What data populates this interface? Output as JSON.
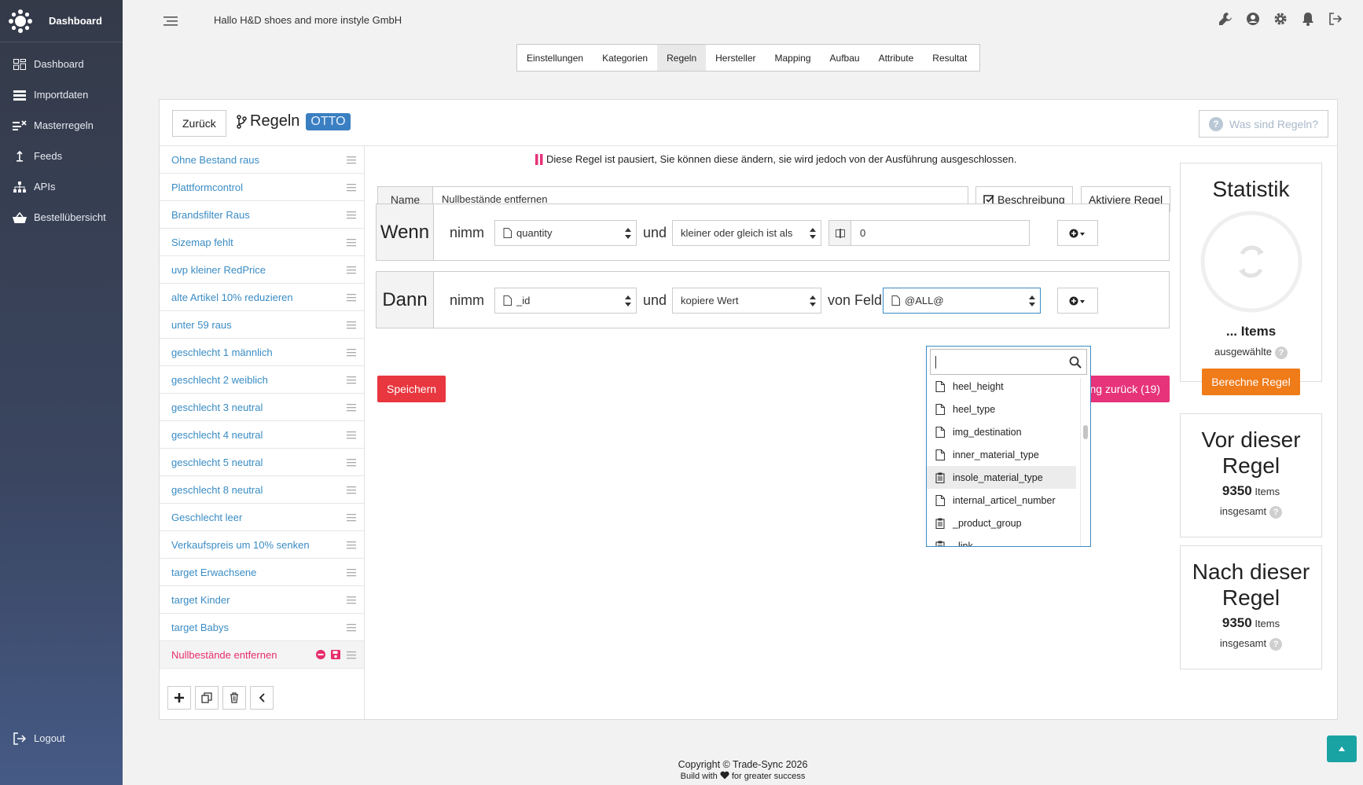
{
  "brand": {
    "name": "Dashboard"
  },
  "nav": [
    {
      "label": "Dashboard",
      "icon": "dashboard-icon"
    },
    {
      "label": "Importdaten",
      "icon": "list-icon"
    },
    {
      "label": "Masterregeln",
      "icon": "rules-icon"
    },
    {
      "label": "Feeds",
      "icon": "upload-icon"
    },
    {
      "label": "APIs",
      "icon": "network-icon"
    },
    {
      "label": "Bestellübersicht",
      "icon": "basket-icon"
    }
  ],
  "logout": "Logout",
  "greeting": "Hallo H&D shoes and more instyle GmbH",
  "steps": [
    "Einstellungen",
    "Kategorien",
    "Regeln",
    "Hersteller",
    "Mapping",
    "Aufbau",
    "Attribute",
    "Resultat"
  ],
  "active_step": "Regeln",
  "header": {
    "back": "Zurück",
    "title": "Regeln",
    "badge": "OTTO",
    "help": "Was sind Regeln?"
  },
  "rules": [
    "Ohne Bestand raus",
    "Plattformcontrol",
    "Brandsfilter Raus",
    "Sizemap fehlt",
    "uvp kleiner RedPrice",
    "alte Artikel 10% reduzieren",
    "unter 59 raus",
    "geschlecht 1 männlich",
    "geschlecht 2 weiblich",
    "geschlecht 3 neutral",
    "geschlecht 4 neutral",
    "geschlecht 5 neutral",
    "geschlecht 8 neutral",
    "Geschlecht leer",
    "Verkaufspreis um 10% senken",
    "target Erwachsene",
    "target Kinder",
    "target Babys"
  ],
  "current_rule": "Nullbestände entfernen",
  "editor": {
    "pause_note": "Diese Regel ist pausiert, Sie können diese ändern, sie wird jedoch von der Ausführung ausgeschlossen.",
    "name_label": "Name",
    "name_value": "Nullbestände entfernen",
    "desc_button": "Beschreibung",
    "activate_button": "Aktiviere Regel",
    "wenn": {
      "keyword": "Wenn",
      "nimm": "nimm",
      "field": "quantity",
      "und": "und",
      "operator": "kleiner oder gleich ist als",
      "value": "0"
    },
    "dann": {
      "keyword": "Dann",
      "nimm": "nimm",
      "field": "_id",
      "und": "und",
      "action": "kopiere Wert",
      "von_feld": "von Feld",
      "source": "@ALL@"
    },
    "save": "Speichern",
    "pink_button": "ng zurück (19)"
  },
  "dropdown": {
    "items": [
      {
        "label": "heel_height",
        "icon": "document-icon"
      },
      {
        "label": "heel_type",
        "icon": "document-icon"
      },
      {
        "label": "img_destination",
        "icon": "document-icon"
      },
      {
        "label": "inner_material_type",
        "icon": "document-icon"
      },
      {
        "label": "insole_material_type",
        "icon": "clipboard-icon",
        "highlighted": true
      },
      {
        "label": "internal_articel_number",
        "icon": "document-icon"
      },
      {
        "label": "_product_group",
        "icon": "clipboard-icon"
      },
      {
        "label": "_link",
        "icon": "clipboard-icon"
      }
    ]
  },
  "stats": {
    "title": "Statistik",
    "items_label": "... Items",
    "selected": "ausgewählte",
    "calc_button": "Berechne Regel",
    "before_title": "Vor dieser Regel",
    "before_count": "9350",
    "after_title": "Nach dieser Regel",
    "after_count": "9350",
    "items_word": "Items",
    "total": "insgesamt"
  },
  "footer": {
    "copyright": "Copyright © Trade-Sync 2026",
    "tagline_a": "Build with",
    "tagline_b": "for greater success"
  },
  "colors": {
    "accent": "#3a8cc4",
    "danger": "#e9373f",
    "pink": "#e6337a",
    "orange": "#f07b19",
    "teal": "#1aa3a3"
  }
}
